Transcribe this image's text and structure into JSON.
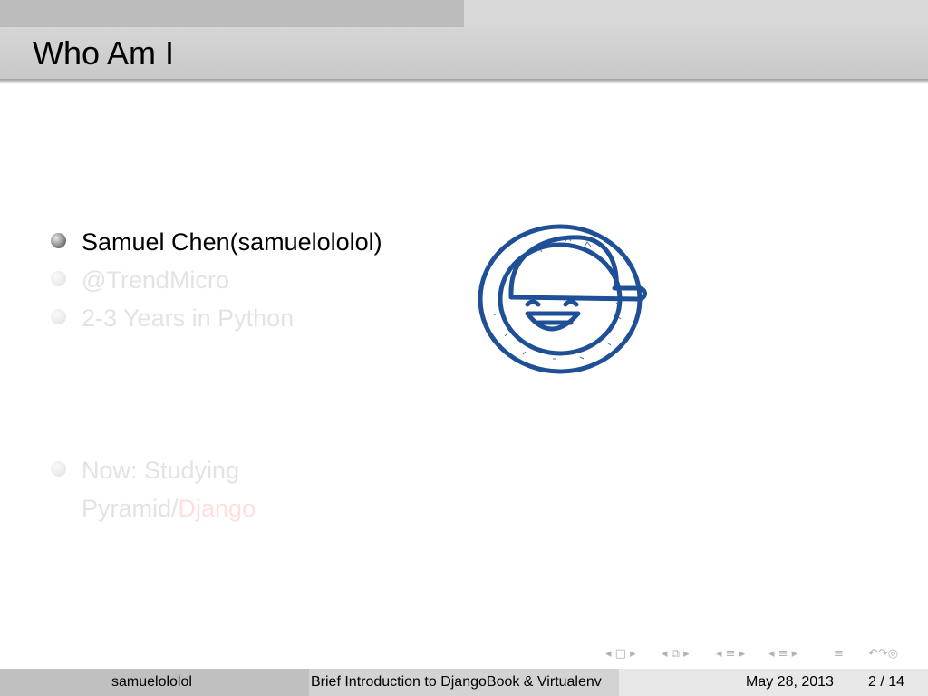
{
  "slide": {
    "title": "Who Am I",
    "bullets": [
      {
        "text": "Samuel Chen(samuelololol)",
        "state": "active"
      },
      {
        "text": "@TrendMicro",
        "state": "faded"
      },
      {
        "text": "2-3 Years in Python",
        "state": "faded"
      },
      {
        "text": "Now: Studying",
        "state": "faded"
      }
    ],
    "now_line2_prefix": "Pyramid/",
    "now_line2_accent": "Django"
  },
  "footer": {
    "author": "samuelololol",
    "talk_title": "Brief Introduction to DjangoBook & Virtualenv",
    "date": "May 28, 2013",
    "page": "2 / 14"
  },
  "colors": {
    "title_bar": "#cccccc",
    "avatar_stroke": "#1f4f96",
    "accent": "#ff0000"
  },
  "icons": [
    "avatar-doodle-icon",
    "beamer-navigation-icons"
  ]
}
